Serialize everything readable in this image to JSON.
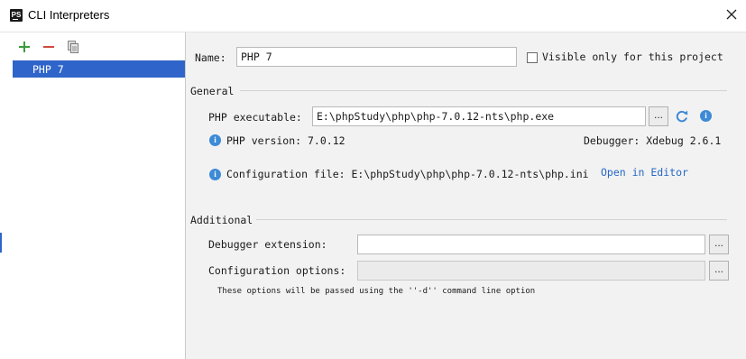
{
  "window": {
    "title": "CLI Interpreters",
    "app_icon_text": "PS"
  },
  "toolbar": {
    "add_icon": "plus-icon",
    "remove_icon": "minus-icon",
    "copy_icon": "copy-icon"
  },
  "interpreters": [
    {
      "label": "PHP 7",
      "selected": true
    }
  ],
  "name": {
    "label": "Name:",
    "value": "PHP 7"
  },
  "visible_only": {
    "label": "Visible only for this project",
    "checked": false
  },
  "general": {
    "title": "General",
    "php_executable_label": "PHP executable:",
    "php_executable_value": "E:\\phpStudy\\php\\php-7.0.12-nts\\php.exe",
    "browse": "...",
    "php_version": "PHP version: 7.0.12",
    "debugger": "Debugger: Xdebug 2.6.1",
    "config_file": "Configuration file: E:\\phpStudy\\php\\php-7.0.12-nts\\php.ini",
    "open_in_editor": "Open in Editor"
  },
  "additional": {
    "title": "Additional",
    "debugger_extension_label": "Debugger extension:",
    "debugger_extension_value": "",
    "config_options_label": "Configuration options:",
    "config_options_value": "",
    "browse": "...",
    "hint": "These options will be passed using the ''-d'' command line option"
  },
  "colors": {
    "selection": "#2f65ca",
    "link": "#2668c4",
    "info": "#3d8ad6",
    "add": "#3c9a3c",
    "remove": "#d04a3d"
  }
}
